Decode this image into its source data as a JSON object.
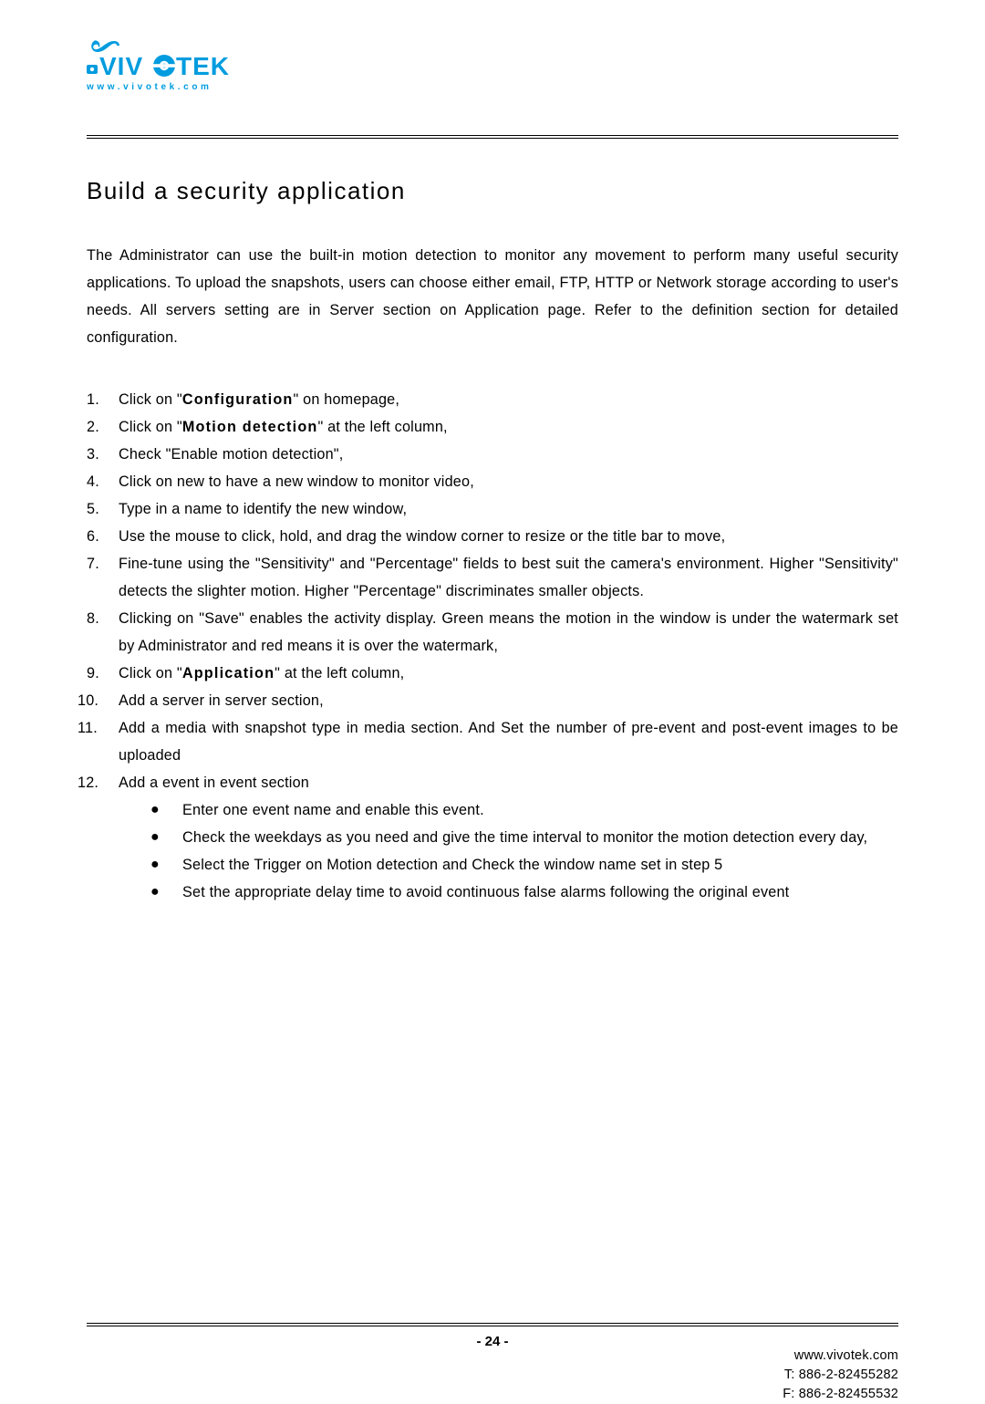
{
  "logo": {
    "name": "VIVOTEK",
    "tagline": "www.vivotek.com",
    "color": "#009CDF"
  },
  "title": "Build a security application",
  "intro": "The Administrator can use the built-in motion detection to monitor any movement to perform many useful security applications. To upload the snapshots, users can choose either email, FTP, HTTP or Network storage according to user's needs. All servers setting are in Server section on Application page. Refer to the definition section for detailed configuration.",
  "steps": [
    {
      "pre": "Click on \"",
      "bold": "Configuration",
      "post": "\" on homepage,"
    },
    {
      "pre": "Click on \"",
      "bold": "Motion detection",
      "post": "\" at the left column,"
    },
    {
      "text": "Check \"Enable motion detection\","
    },
    {
      "text": "Click on new to have a new window to monitor video,"
    },
    {
      "text": "Type in a name to identify the new window,"
    },
    {
      "text": "Use the mouse to click, hold, and drag the window corner to resize or the title bar to move,"
    },
    {
      "text": "Fine-tune using the \"Sensitivity\" and \"Percentage\" fields to best suit the camera's environment. Higher \"Sensitivity\" detects the slighter motion. Higher \"Percentage\" discriminates smaller objects."
    },
    {
      "text": "Clicking on \"Save\" enables the activity display. Green means the motion in the window is under the watermark set by Administrator and red means it is over the watermark,"
    },
    {
      "pre": "Click on \"",
      "bold": "Application",
      "post": "\" at the left column,"
    },
    {
      "text": "Add a server in server section,"
    },
    {
      "text": "Add a media with snapshot type in media section. And Set the number of pre-event and post-event images to be uploaded"
    },
    {
      "text": "Add a event in event section",
      "sub": [
        "Enter one event name and enable this event.",
        "Check the weekdays as you need and give the time interval to monitor the motion detection every day,",
        "Select the Trigger on Motion detection and Check the window name set in step 5",
        "Set the appropriate delay time to avoid continuous false alarms following the original event"
      ]
    }
  ],
  "footer": {
    "page_number": "- 24 -",
    "url": "www.vivotek.com",
    "tel": "T: 886-2-82455282",
    "fax": "F: 886-2-82455532"
  }
}
